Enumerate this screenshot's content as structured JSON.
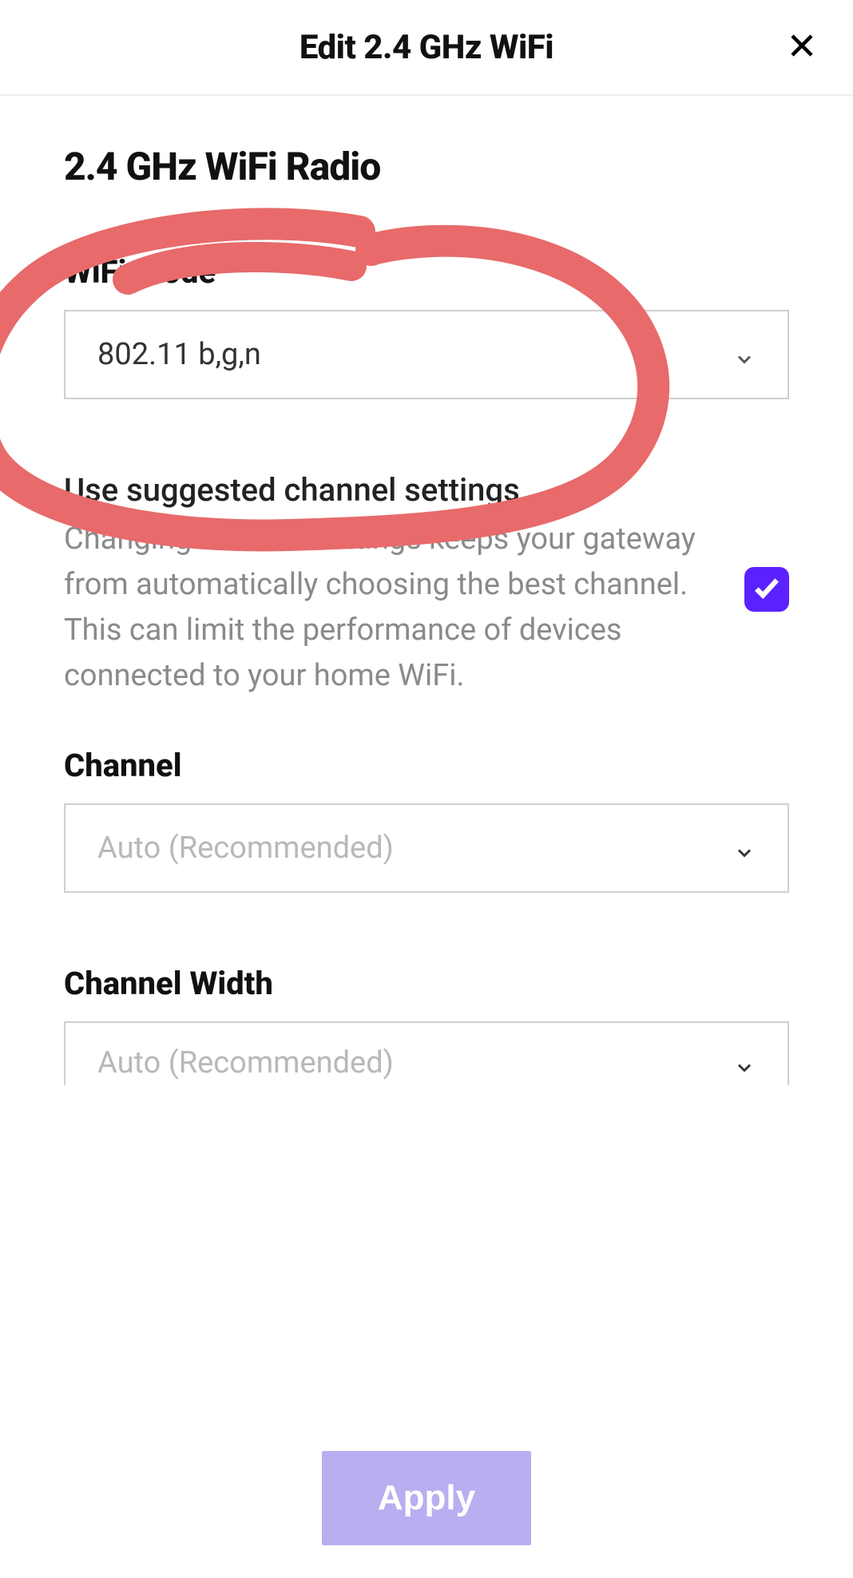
{
  "header": {
    "title": "Edit 2.4 GHz WiFi"
  },
  "section": {
    "title": "2.4 GHz WiFi Radio"
  },
  "wifi_mode": {
    "label": "WiFi Mode",
    "value": "802.11 b,g,n"
  },
  "suggested": {
    "title": "Use suggested channel settings",
    "desc": "Changing channel settings keeps your gateway from automatically choosing the best channel. This can limit the performance of devices connected to your home WiFi.",
    "checked": true
  },
  "channel": {
    "label": "Channel",
    "value": "Auto (Recommended)"
  },
  "channel_width": {
    "label": "Channel Width",
    "value": "Auto (Recommended)"
  },
  "footer": {
    "apply": "Apply"
  },
  "colors": {
    "accent": "#5b21ff",
    "apply_bg": "#b9aef0",
    "annotation": "#e86a6a"
  }
}
